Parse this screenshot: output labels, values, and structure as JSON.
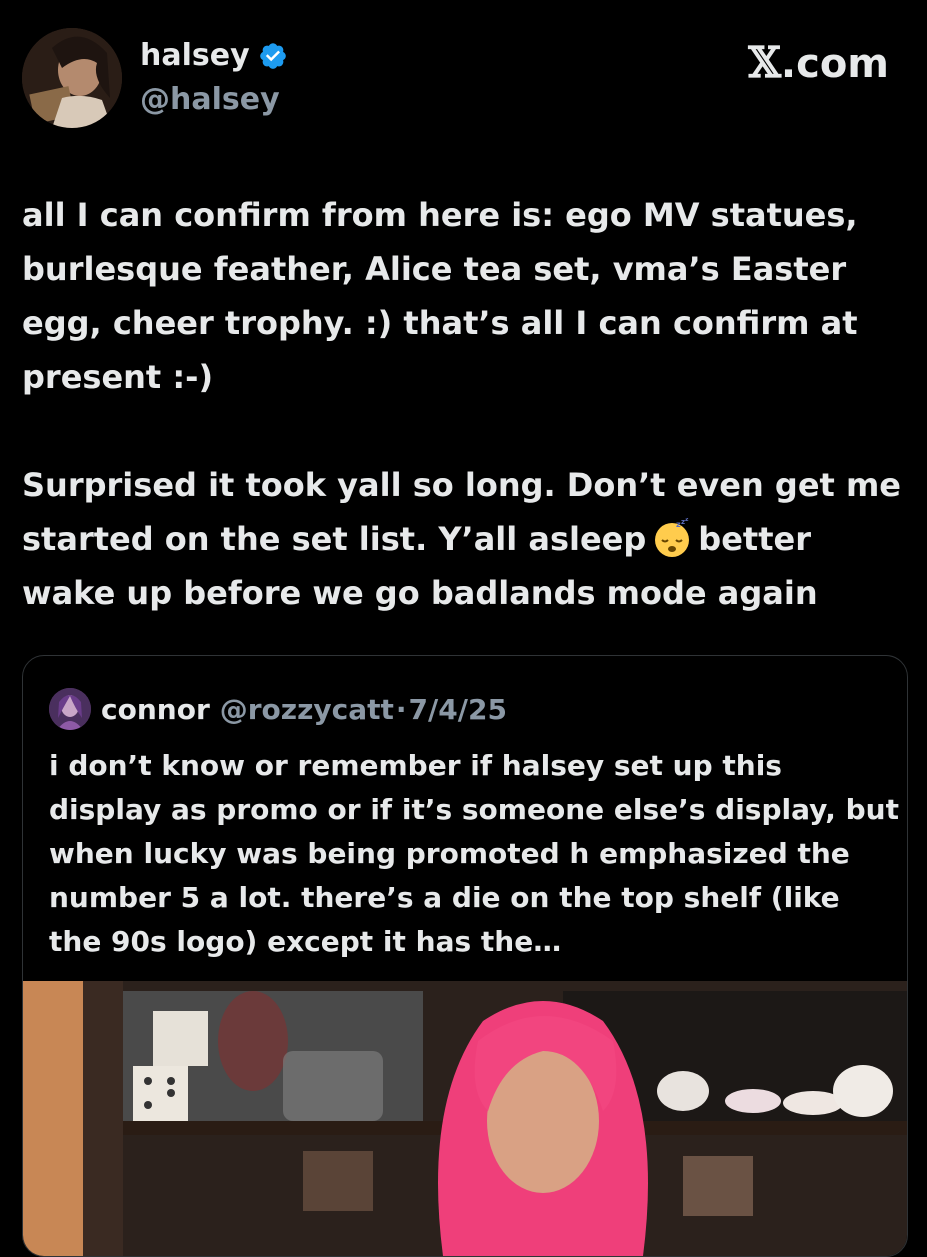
{
  "author": {
    "name": "halsey",
    "handle": "@halsey",
    "verified": true
  },
  "brand": {
    "logo": "𝕏",
    "suffix": ".com"
  },
  "tweet": {
    "paragraph1": "all I can confirm from here is: ego MV statues, burlesque feather, Alice tea set, vma’s Easter egg, cheer trophy. :) that’s all I can confirm at present :-)",
    "paragraph2_before": "Surprised it took yall so long. Don’t even get me started on the set list. Y’all asleep",
    "paragraph2_emoji": "sleeping-face-icon",
    "paragraph2_after": "better wake up before we go badlands mode again"
  },
  "quote": {
    "name": "connor",
    "handle": "@rozzycatt",
    "separator": "·",
    "date": "7/4/25",
    "text": "i don’t know or remember if halsey set up this display as promo or if it’s someone else’s display, but when lucky was being promoted h emphasized the number 5 a lot. there’s a die on the top shelf (like the 90s logo) except it has the…"
  },
  "colors": {
    "background": "#000000",
    "text": "#e7e9ea",
    "secondary": "#8b98a5",
    "verified": "#1d9bf0",
    "border": "#2f3336"
  }
}
